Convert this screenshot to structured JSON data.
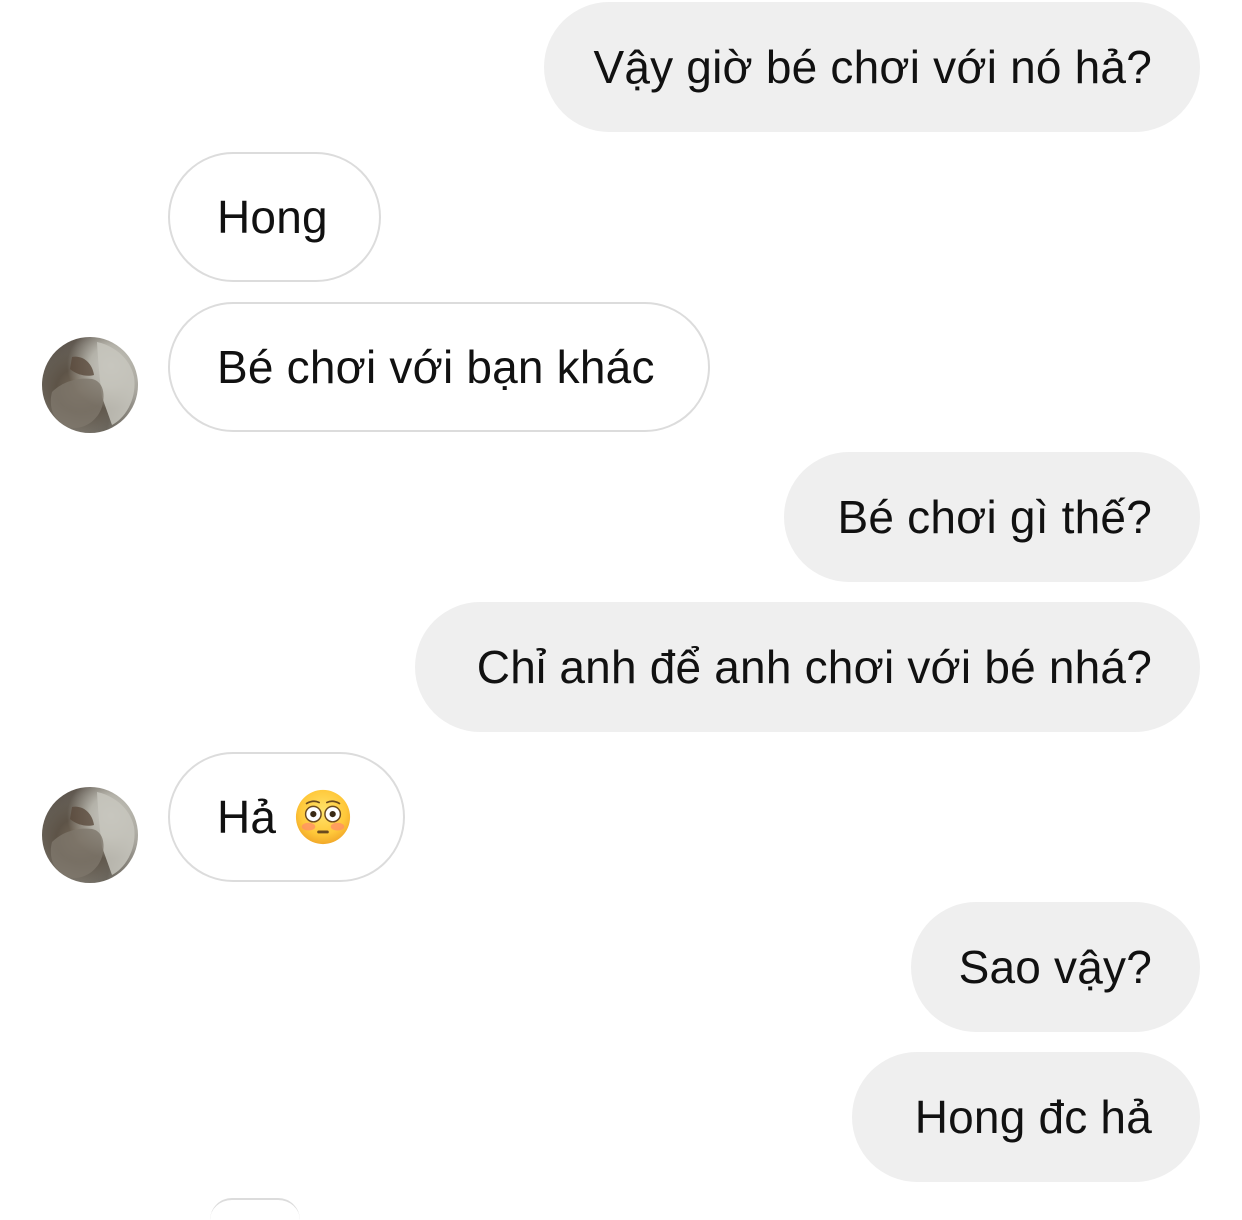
{
  "chat": {
    "messages": [
      {
        "sender": "me",
        "text": "Vậy giờ bé chơi với nó hả?"
      },
      {
        "sender": "them",
        "text": "Hong"
      },
      {
        "sender": "them",
        "text": "Bé chơi với bạn khác"
      },
      {
        "sender": "me",
        "text": "Bé chơi gì thế?"
      },
      {
        "sender": "me",
        "text": "Chỉ anh để anh chơi với bé nhá?"
      },
      {
        "sender": "them",
        "text": "Hả",
        "emoji": "flushed-face-emoji"
      },
      {
        "sender": "me",
        "text": "Sao vậy?"
      },
      {
        "sender": "me",
        "text": "Hong đc hả"
      }
    ]
  },
  "colors": {
    "sent_bubble": "#efefef",
    "received_border": "#dcdcdc",
    "text": "#111111",
    "background": "#ffffff"
  },
  "icons": {
    "avatar": "contact-avatar-photo",
    "emoji": "flushed-face-emoji"
  }
}
